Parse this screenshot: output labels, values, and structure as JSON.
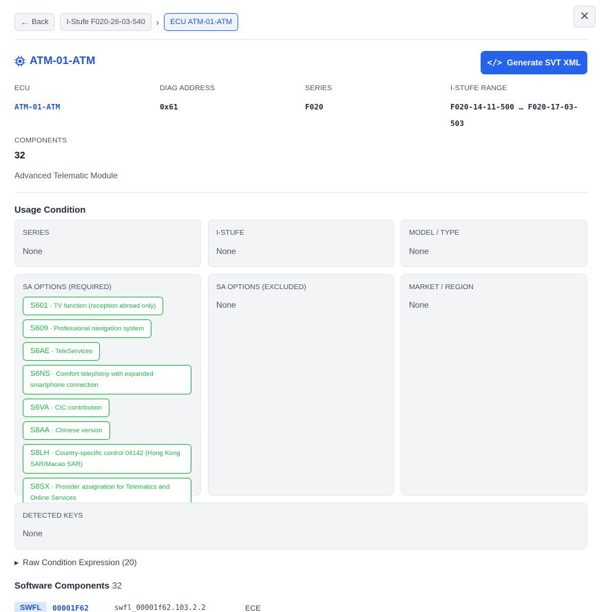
{
  "breadcrumb": {
    "back_label": "Back",
    "parent_label": "I-Stufe F020-26-03-540",
    "current_label": "ECU ATM-01-ATM"
  },
  "close_label": "✕",
  "header": {
    "title": "ATM-01-ATM",
    "generate_button": "Generate SVT XML"
  },
  "meta": {
    "ecu_label": "ECU",
    "ecu_value": "ATM-01-ATM",
    "diag_label": "DIAG ADDRESS",
    "diag_value": "0x61",
    "series_label": "SERIES",
    "series_value": "F020",
    "range_label": "I-STUFE RANGE",
    "range_value": "F020-14-11-500 … F020-17-03-503",
    "components_label": "COMPONENTS",
    "components_value": "32",
    "description": "Advanced Telematic Module"
  },
  "usage": {
    "title": "Usage Condition",
    "series": {
      "label": "SERIES",
      "value": "None"
    },
    "istufe": {
      "label": "I-STUFE",
      "value": "None"
    },
    "model": {
      "label": "MODEL / TYPE",
      "value": "None"
    },
    "sa_required": {
      "label": "SA OPTIONS (REQUIRED)",
      "options": [
        {
          "code": "S601",
          "text": "TV function (reception abroad only)"
        },
        {
          "code": "S609",
          "text": "Professional navigation system"
        },
        {
          "code": "S6AE",
          "text": "TeleServices"
        },
        {
          "code": "S6NS",
          "text": "Comfort telephony with expanded smartphone connection"
        },
        {
          "code": "S6VA",
          "text": "CIC contribution"
        },
        {
          "code": "S8AA",
          "text": "Chinese version"
        },
        {
          "code": "S8LH",
          "text": "Country-specific control 04142 (Hong Kong SAR/Macao SAR)"
        },
        {
          "code": "S8SX",
          "text": "Provider assignation for Telematics and Online Services"
        }
      ]
    },
    "sa_excluded": {
      "label": "SA OPTIONS (EXCLUDED)",
      "value": "None"
    },
    "market": {
      "label": "MARKET / REGION",
      "value": "None"
    },
    "detected_keys": {
      "label": "DETECTED KEYS",
      "value": "None"
    },
    "raw_expression": "Raw Condition Expression (20)"
  },
  "software": {
    "title": "Software Components",
    "count": "32",
    "rows": [
      {
        "type": "SWFL",
        "id": "00001F62",
        "file": "swfl_00001f62.103.2.2",
        "ext": "ECE"
      }
    ]
  }
}
